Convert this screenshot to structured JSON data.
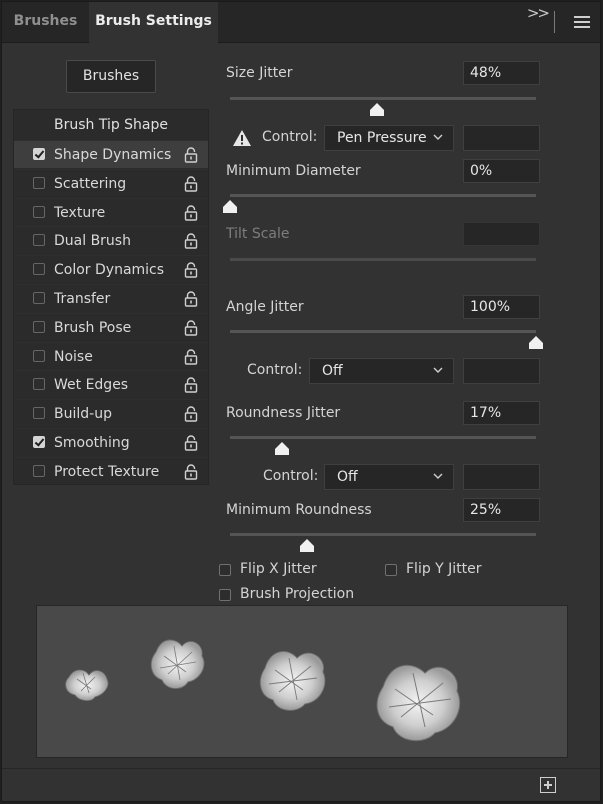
{
  "tabs": {
    "brushes": "Brushes",
    "brush_settings": "Brush Settings"
  },
  "brushes_button": "Brushes",
  "tip_shape_label": "Brush Tip Shape",
  "options": [
    {
      "label": "Shape Dynamics",
      "checked": true,
      "selected": true
    },
    {
      "label": "Scattering",
      "checked": false
    },
    {
      "label": "Texture",
      "checked": false
    },
    {
      "label": "Dual Brush",
      "checked": false
    },
    {
      "label": "Color Dynamics",
      "checked": false
    },
    {
      "label": "Transfer",
      "checked": false
    },
    {
      "label": "Brush Pose",
      "checked": false
    },
    {
      "label": "Noise",
      "checked": false
    },
    {
      "label": "Wet Edges",
      "checked": false
    },
    {
      "label": "Build-up",
      "checked": false
    },
    {
      "label": "Smoothing",
      "checked": true
    },
    {
      "label": "Protect Texture",
      "checked": false
    }
  ],
  "size_jitter": {
    "label": "Size Jitter",
    "value": "48%",
    "percent": 48
  },
  "size_control": {
    "label": "Control:",
    "value": "Pen Pressure",
    "warning_icon": "warning-icon"
  },
  "minimum_diameter": {
    "label": "Minimum Diameter",
    "value": "0%",
    "percent": 0
  },
  "tilt_scale": {
    "label": "Tilt Scale",
    "value": ""
  },
  "angle_jitter": {
    "label": "Angle Jitter",
    "value": "100%",
    "percent": 100
  },
  "angle_control": {
    "label": "Control:",
    "value": "Off"
  },
  "roundness_jitter": {
    "label": "Roundness Jitter",
    "value": "17%",
    "percent": 17
  },
  "roundness_control": {
    "label": "Control:",
    "value": "Off"
  },
  "minimum_roundness": {
    "label": "Minimum Roundness",
    "value": "25%",
    "percent": 25
  },
  "flip_x": {
    "label": "Flip X Jitter",
    "checked": false
  },
  "flip_y": {
    "label": "Flip Y Jitter",
    "checked": false
  },
  "brush_projection": {
    "label": "Brush Projection",
    "checked": false
  },
  "colors": {
    "panel": "#323232",
    "tabbar": "#262626",
    "field": "#262626",
    "text": "#d6d6d6"
  }
}
